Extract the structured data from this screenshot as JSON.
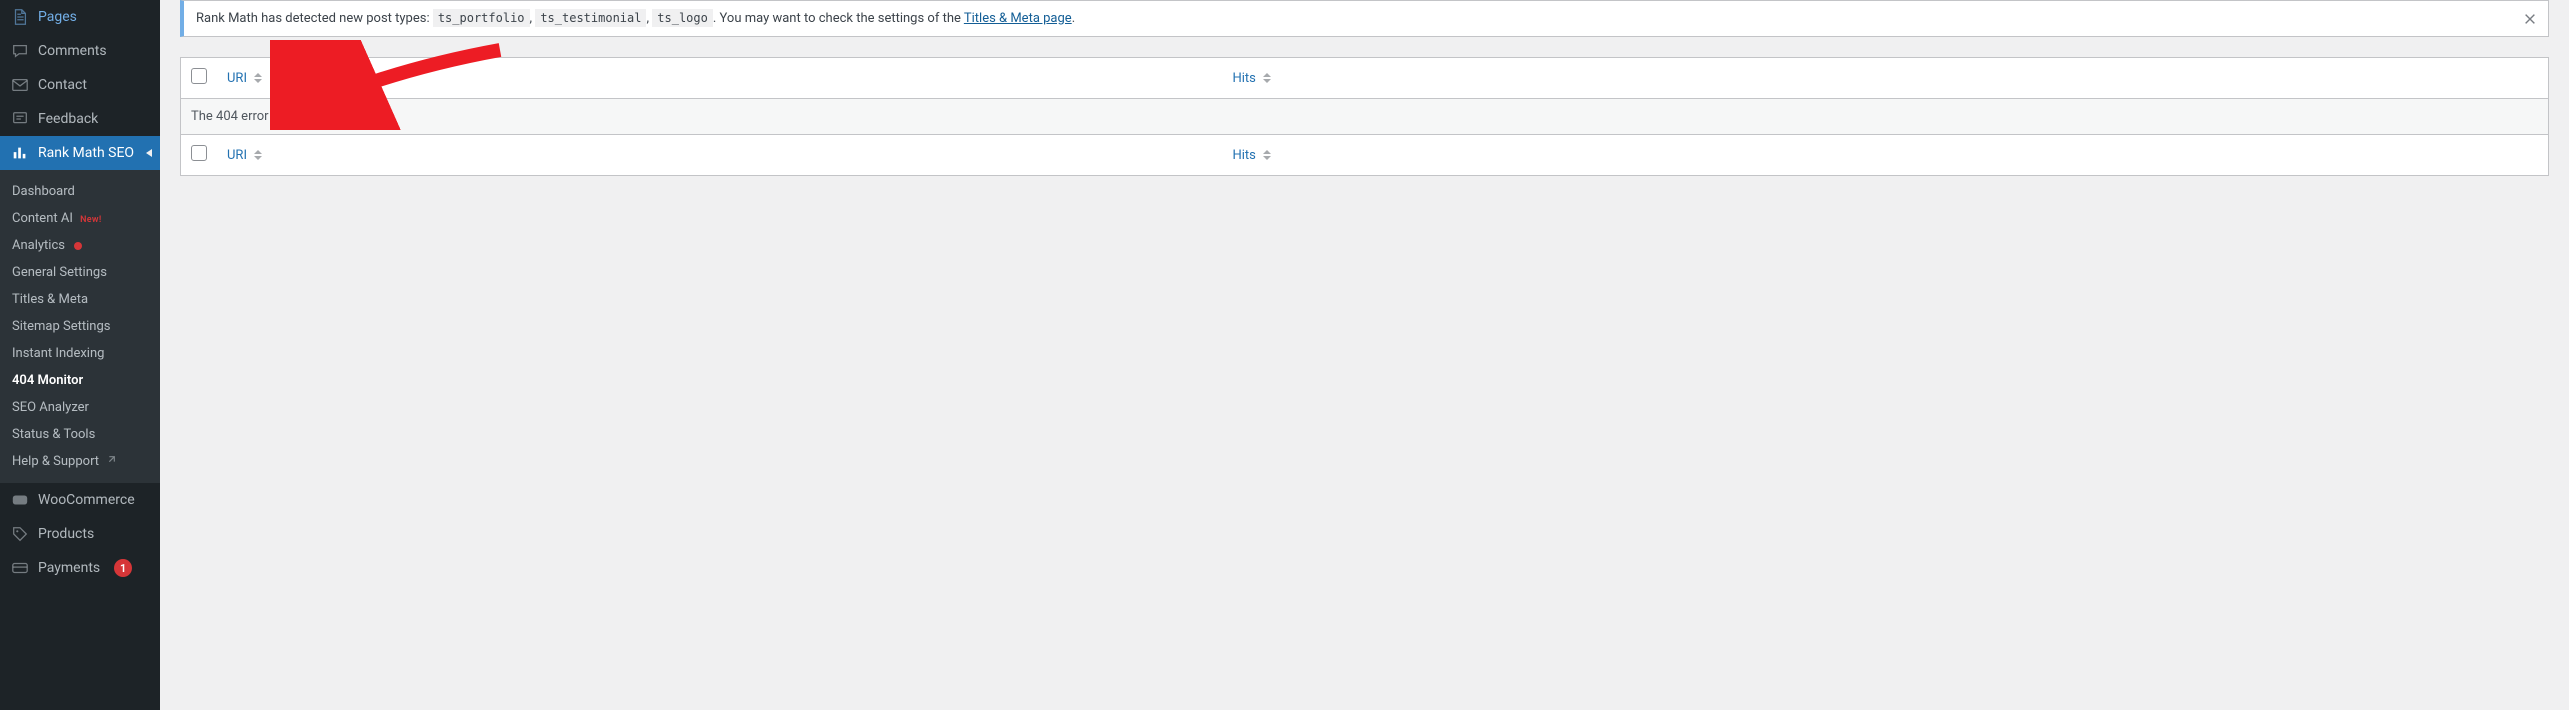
{
  "sidebar": {
    "primary": [
      {
        "id": "pages",
        "label": "Pages",
        "icon": "pages"
      },
      {
        "id": "comments",
        "label": "Comments",
        "icon": "comment"
      },
      {
        "id": "contact",
        "label": "Contact",
        "icon": "mail"
      },
      {
        "id": "feedback",
        "label": "Feedback",
        "icon": "feedback"
      }
    ],
    "current": {
      "id": "rankmath",
      "label": "Rank Math SEO",
      "icon": "chart"
    },
    "submenu": [
      {
        "id": "dashboard",
        "label": "Dashboard"
      },
      {
        "id": "content-ai",
        "label": "Content AI",
        "badge_new": "New!"
      },
      {
        "id": "analytics",
        "label": "Analytics",
        "dot": true
      },
      {
        "id": "general-settings",
        "label": "General Settings"
      },
      {
        "id": "titles-meta",
        "label": "Titles & Meta"
      },
      {
        "id": "sitemap",
        "label": "Sitemap Settings"
      },
      {
        "id": "instant-indexing",
        "label": "Instant Indexing"
      },
      {
        "id": "404-monitor",
        "label": "404 Monitor",
        "active": true
      },
      {
        "id": "seo-analyzer",
        "label": "SEO Analyzer"
      },
      {
        "id": "status-tools",
        "label": "Status & Tools"
      },
      {
        "id": "help-support",
        "label": "Help & Support",
        "external": true
      }
    ],
    "after": [
      {
        "id": "woocommerce",
        "label": "WooCommerce",
        "icon": "woo"
      },
      {
        "id": "products",
        "label": "Products",
        "icon": "product"
      },
      {
        "id": "payments",
        "label": "Payments",
        "icon": "payments",
        "count": 1
      }
    ]
  },
  "notice": {
    "prefix": "Rank Math has detected new post types: ",
    "codes": [
      "ts_portfolio",
      "ts_testimonial",
      "ts_logo"
    ],
    "middle": ". You may want to check the settings of the ",
    "link": "Titles & Meta page",
    "suffix": "."
  },
  "table": {
    "col_uri": "URI",
    "col_hits": "Hits",
    "empty_message": "The 404 error log is empty."
  }
}
